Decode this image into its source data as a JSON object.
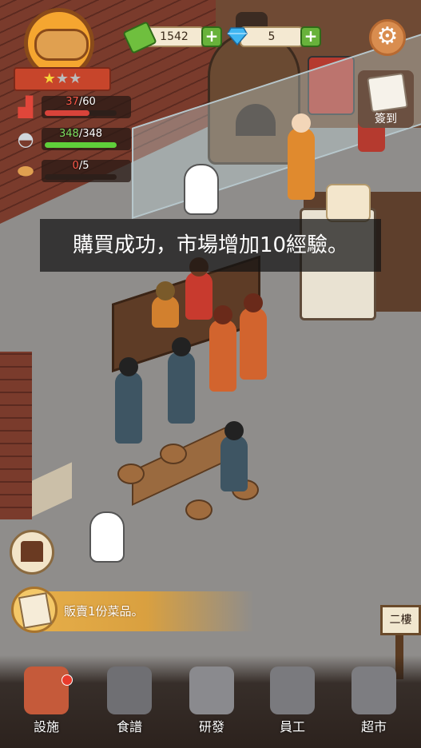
{
  "status": {
    "stars_filled": 1,
    "stars_total": 3,
    "seats": {
      "current": "37",
      "max": "/60",
      "fill_fraction": 0.62,
      "color": "#d8433a"
    },
    "service": {
      "current": "348",
      "max": "/348",
      "fill_fraction": 1.0,
      "color": "#5fcf3a"
    },
    "bread": {
      "current": "0",
      "max": "/5",
      "fill_fraction": 0.0,
      "color": "#d8433a"
    }
  },
  "currency": {
    "cash": "1542",
    "gems": "5"
  },
  "signin": {
    "label": "簽到"
  },
  "toast": {
    "message": "購買成功，市場增加10經驗。"
  },
  "quest": {
    "text": "販賣1份菜品。"
  },
  "floor_sign": {
    "label": "二樓"
  },
  "nav": {
    "facilities": "設施",
    "recipes": "食譜",
    "research": "研發",
    "staff": "員工",
    "market": "超市"
  },
  "icons": {
    "seat": "armchair-icon",
    "service": "cloche-icon",
    "bread": "bread-icon",
    "cash": "cash-icon",
    "gem": "diamond-icon",
    "settings": "gear-icon"
  }
}
